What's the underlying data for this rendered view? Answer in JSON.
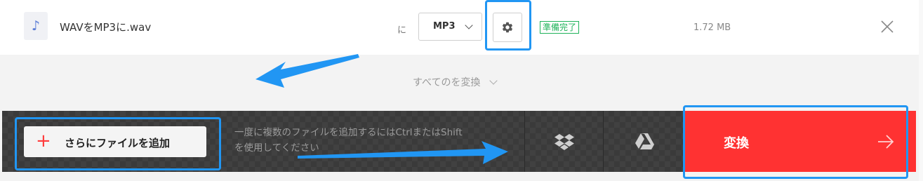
{
  "file": {
    "icon": "music-note-icon",
    "name": "WAVをMP3に.wav",
    "to_label": "に",
    "format": "MP3",
    "status": "準備完了",
    "size": "1.72 MB"
  },
  "convert_all": {
    "label": "すべてのを変換"
  },
  "bottom": {
    "add_files_label": "さらにファイルを追加",
    "hint_line1": "一度に複数のファイルを追加するにはCtrlまたはShift",
    "hint_line2": "を使用してください",
    "convert_label": "変換"
  },
  "colors": {
    "accent_red": "#ff3232",
    "highlight_blue": "#2196f3",
    "status_green": "#1fb35a",
    "bar_dark": "#3a3a3a"
  }
}
